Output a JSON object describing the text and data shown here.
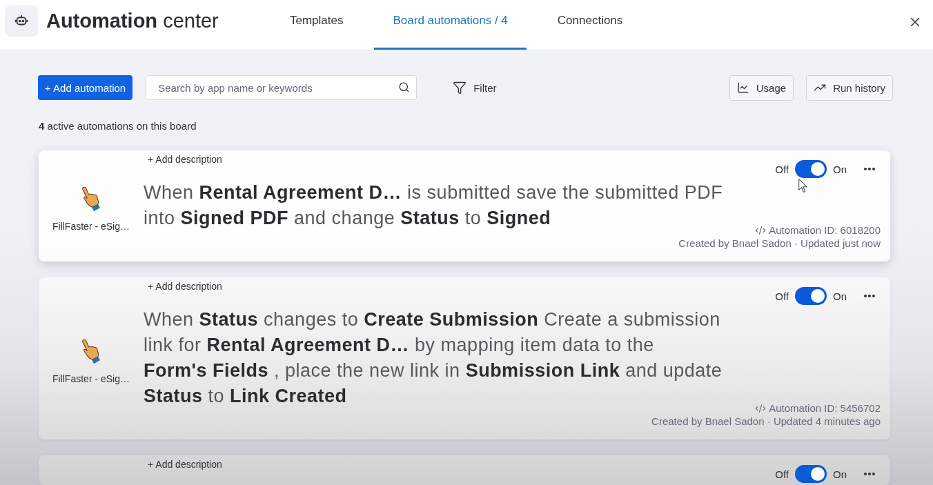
{
  "header": {
    "title": "**Automation** center",
    "tabs": [
      {
        "label": "Templates",
        "selected": false
      },
      {
        "label": "Board automations / 4",
        "selected": true
      },
      {
        "label": "Connections",
        "selected": false
      }
    ]
  },
  "toolbar": {
    "add_button": "+ Add automation",
    "search": {
      "placeholder": "Search by app name or keywords"
    },
    "filter": "Filter",
    "buttons": [
      {
        "kind": "usage",
        "label": "Usage"
      },
      {
        "kind": "history",
        "label": "Run history"
      }
    ]
  },
  "summary": "**4** active automations on this board",
  "automations": [
    {
      "add_description": "+ Add description",
      "app": {
        "name": "FillFaster - eSig…"
      },
      "sentence": [
        "When **Rental Agreement D…** is submitted save the submitted PDF",
        "into **Signed PDF** and change **Status** to **Signed**"
      ],
      "off_label": "Off",
      "on_label": "On",
      "on": true,
      "hovered": true,
      "automation_id": "Automation ID: 6018200",
      "created": "Created by Bnael Sadon · Updated just now"
    },
    {
      "add_description": "+ Add description",
      "app": {
        "name": "FillFaster - eSig…"
      },
      "sentence": [
        "When **Status** changes to **Create Submission** Create a submission",
        "link for **Rental Agreement D…** by mapping item data to the",
        "**Form's Fields** , place the new link in **Submission Link** and update",
        "**Status** to **Link Created**"
      ],
      "off_label": "Off",
      "on_label": "On",
      "on": true,
      "hovered": false,
      "automation_id": "Automation ID: 5456702",
      "created": "Created by Bnael Sadon · Updated 4 minutes ago"
    },
    {
      "add_description": "+ Add description",
      "off_label": "Off",
      "on_label": "On",
      "on": true,
      "hovered": false
    }
  ]
}
